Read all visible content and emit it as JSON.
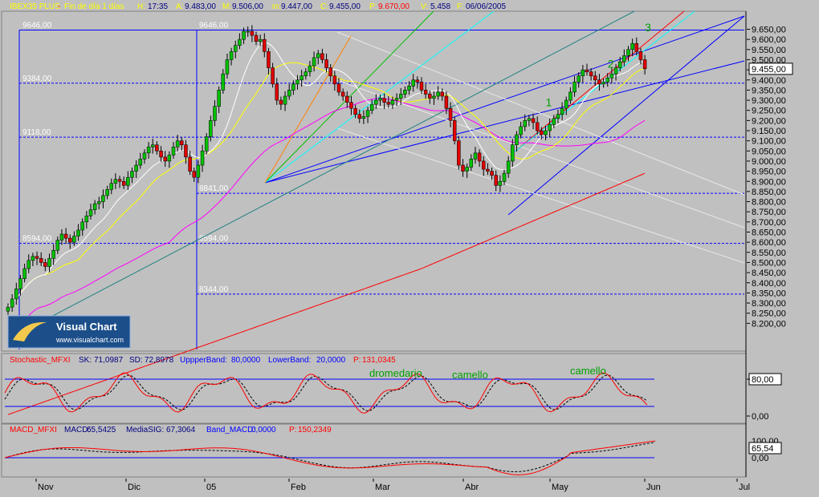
{
  "header": {
    "symbol": "IBEX35 PLUS",
    "desc": "Fin de día 1 días",
    "time_label": "H:",
    "time": "17:35",
    "a_label": "A:",
    "a": "9.483,00",
    "m_label": "M:",
    "m": "9.506,00",
    "m2_label": "m:",
    "m2": "9.447,00",
    "c_label": "C:",
    "c": "9.455,00",
    "p_label": "P:",
    "p": "9.670,00",
    "v_label": "V:",
    "v": "5.458",
    "f_label": "F:",
    "f": "06/06/2005"
  },
  "logo": {
    "title": "Visual Chart",
    "url": "www.visualchart.com"
  },
  "colors": {
    "bg": "#c0c0c0",
    "up": "#00c000",
    "down": "#e00000",
    "grid_blue": "#0000ff",
    "ma_red": "#ff0000",
    "ma_magenta": "#ff00ff",
    "ma_yellow": "#ffff00",
    "ma_white": "#ffffff",
    "cyan": "#00ffff"
  },
  "chart_data": [
    {
      "type": "candlestick",
      "title": "IBEX35 PLUS",
      "ylim": [
        8100,
        9700
      ],
      "y_ticks": [
        "9.650,00",
        "9.600,00",
        "9.550,00",
        "9.500,00",
        "9.450,00",
        "9.400,00",
        "9.350,00",
        "9.300,00",
        "9.250,00",
        "9.200,00",
        "9.150,00",
        "9.100,00",
        "9.050,00",
        "9.000,00",
        "8.950,00",
        "8.900,00",
        "8.850,00",
        "8.800,00",
        "8.750,00",
        "8.700,00",
        "8.650,00",
        "8.600,00",
        "8.550,00",
        "8.500,00",
        "8.450,00",
        "8.400,00",
        "8.350,00",
        "8.300,00",
        "8.250,00",
        "8.200,00"
      ],
      "x_ticks": [
        "Nov",
        "Dic",
        "05",
        "Feb",
        "Mar",
        "Abr",
        "May",
        "Jun",
        "Jul"
      ],
      "last_value_label": "9.455,00",
      "last_close": 9455,
      "levels": [
        {
          "label": "9646,00",
          "value": 9646
        },
        {
          "label": "9384,00",
          "value": 9384
        },
        {
          "label": "9118,00",
          "value": 9118
        },
        {
          "label": "8841,00",
          "value": 8841
        },
        {
          "label": "8594,00",
          "value": 8594
        },
        {
          "label": "8344,00",
          "value": 8344
        }
      ],
      "wave_labels": [
        {
          "label": "1",
          "date_index": 130,
          "value": 9270
        },
        {
          "label": "2",
          "date_index": 145,
          "value": 9460
        },
        {
          "label": "3",
          "date_index": 154,
          "value": 9640
        }
      ],
      "closes": [
        8280,
        8320,
        8370,
        8420,
        8470,
        8510,
        8530,
        8520,
        8500,
        8480,
        8520,
        8560,
        8610,
        8640,
        8620,
        8600,
        8630,
        8660,
        8700,
        8730,
        8760,
        8790,
        8800,
        8830,
        8860,
        8890,
        8910,
        8900,
        8880,
        8920,
        8950,
        8980,
        9010,
        9040,
        9070,
        9080,
        9050,
        9020,
        9000,
        9030,
        9070,
        9100,
        9080,
        9020,
        8950,
        8920,
        8980,
        9050,
        9120,
        9200,
        9270,
        9350,
        9430,
        9500,
        9540,
        9570,
        9600,
        9640,
        9640,
        9620,
        9590,
        9600,
        9540,
        9460,
        9380,
        9300,
        9280,
        9320,
        9350,
        9380,
        9400,
        9420,
        9440,
        9470,
        9510,
        9530,
        9500,
        9460,
        9420,
        9380,
        9340,
        9320,
        9290,
        9260,
        9230,
        9210,
        9220,
        9250,
        9280,
        9300,
        9310,
        9290,
        9280,
        9300,
        9310,
        9330,
        9350,
        9370,
        9400,
        9390,
        9350,
        9330,
        9310,
        9320,
        9340,
        9320,
        9260,
        9200,
        9100,
        8980,
        8950,
        8970,
        9010,
        9040,
        9000,
        8960,
        8950,
        8930,
        8880,
        8900,
        8940,
        9000,
        9080,
        9130,
        9170,
        9200,
        9210,
        9190,
        9150,
        9130,
        9150,
        9180,
        9210,
        9230,
        9260,
        9300,
        9340,
        9390,
        9420,
        9450,
        9440,
        9420,
        9400,
        9380,
        9390,
        9410,
        9430,
        9460,
        9490,
        9520,
        9550,
        9580,
        9540,
        9500,
        9455
      ]
    },
    {
      "type": "line",
      "title": "Stochastic_MFXI",
      "sk_label": "SK:",
      "sk": "71,0987",
      "sd_label": "SD:",
      "sd": "72,8978",
      "upper_label": "UppperBand:",
      "upper": "80,0000",
      "lower_label": "LowerBand:",
      "lower": "20,0000",
      "p_label": "P:",
      "p": "131,0345",
      "annotations": [
        "dromedario",
        "camello",
        "camello"
      ],
      "y_ticks": [
        "80,00",
        "0,00"
      ],
      "bands": [
        80,
        20
      ],
      "last_value_label": "80,00"
    },
    {
      "type": "line",
      "title": "MACD_MFXI",
      "macd_label": "MACD:",
      "macd": "65,5425",
      "sig_label": "MediaSIG:",
      "sig": "67,3064",
      "band_label": "Band_MACD:",
      "band": "0,0000",
      "p_label": "P:",
      "p": "150,2349",
      "y_ticks": [
        "100,00",
        "0,00"
      ],
      "last_value_label": "65,54"
    }
  ]
}
